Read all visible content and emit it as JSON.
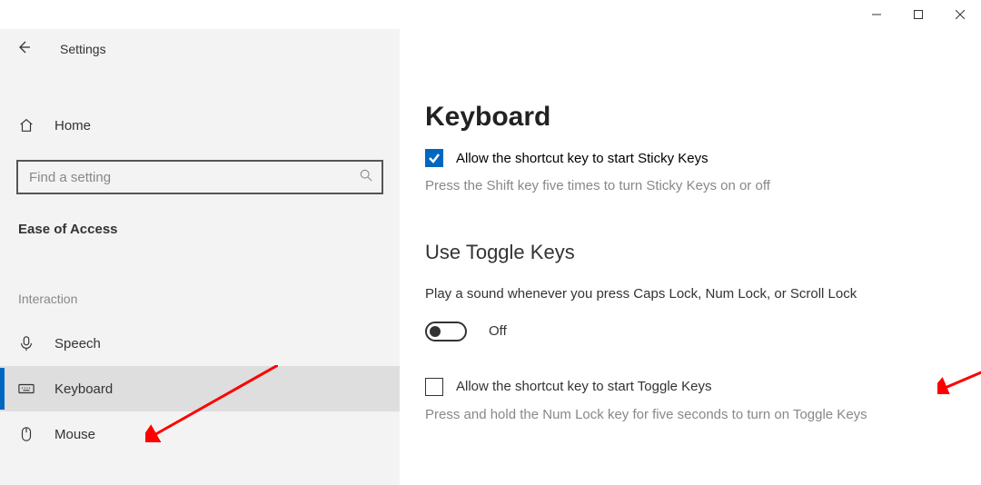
{
  "window": {
    "title": "Settings"
  },
  "sidebar": {
    "home_label": "Home",
    "search_placeholder": "Find a setting",
    "category_label": "Ease of Access",
    "group_label": "Interaction",
    "items": [
      {
        "label": "Speech"
      },
      {
        "label": "Keyboard"
      },
      {
        "label": "Mouse"
      }
    ],
    "active_index": 1
  },
  "content": {
    "page_title": "Keyboard",
    "sticky_keys_checkbox": "Allow the shortcut key to start Sticky Keys",
    "sticky_keys_desc": "Press the Shift key five times to turn Sticky Keys on or off",
    "toggle_keys_heading": "Use Toggle Keys",
    "toggle_keys_desc": "Play a sound whenever you press Caps Lock, Num Lock, or Scroll Lock",
    "toggle_state": "Off",
    "toggle_keys_shortcut_checkbox": "Allow the shortcut key to start Toggle Keys",
    "toggle_keys_shortcut_desc": "Press and hold the Num Lock key for five seconds to turn on Toggle Keys"
  }
}
